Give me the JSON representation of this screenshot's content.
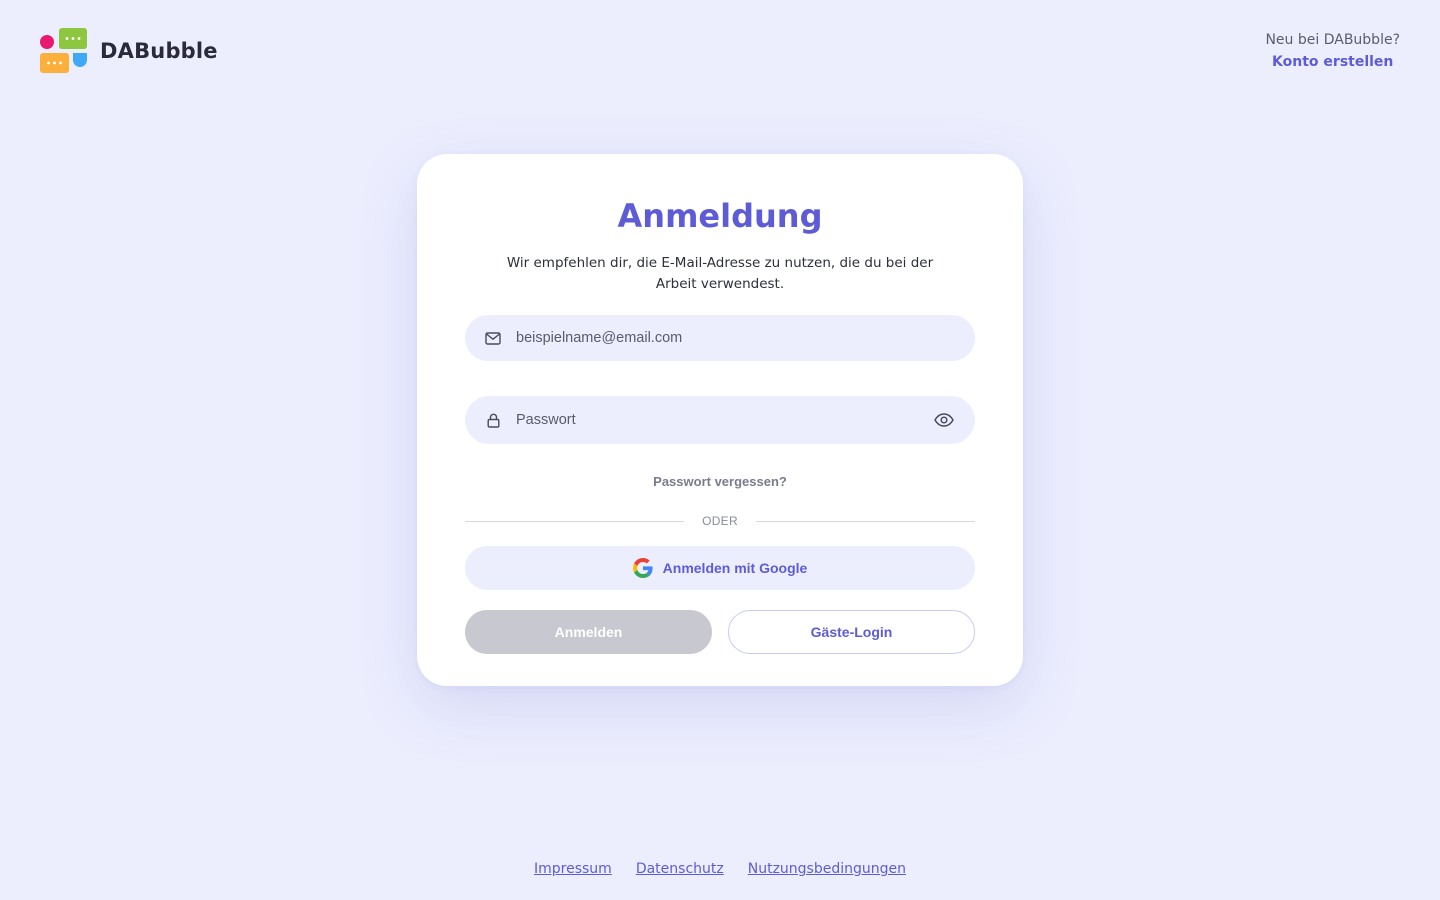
{
  "header": {
    "brand": "DABubble",
    "logo_icon": "chat-bubbles-logo",
    "signup_question": "Neu bei DABubble?",
    "signup_link": "Konto erstellen"
  },
  "login": {
    "title": "Anmeldung",
    "subtitle": "Wir empfehlen dir, die E-Mail-Adresse zu nutzen, die du bei der Arbeit verwendest.",
    "email": {
      "value": "",
      "placeholder": "beispielname@email.com",
      "icon": "mail-icon"
    },
    "password": {
      "value": "",
      "placeholder": "Passwort",
      "icon": "lock-icon",
      "toggle_icon": "eye-icon"
    },
    "forgot_password": "Passwort vergessen?",
    "divider_text": "ODER",
    "google_button": "Anmelden mit Google",
    "login_button": "Anmelden",
    "guest_button": "Gäste-Login"
  },
  "footer": {
    "links": [
      "Impressum",
      "Datenschutz",
      "Nutzungsbedingungen"
    ]
  },
  "colors": {
    "background": "#eceefe",
    "accent": "#5d5cd6",
    "card": "#ffffff",
    "disabled_button": "#c7c8d0",
    "logo_pink": "#e8196f",
    "logo_green": "#8dc63f",
    "logo_orange": "#fbb03b",
    "logo_blue": "#3fa9f5"
  }
}
